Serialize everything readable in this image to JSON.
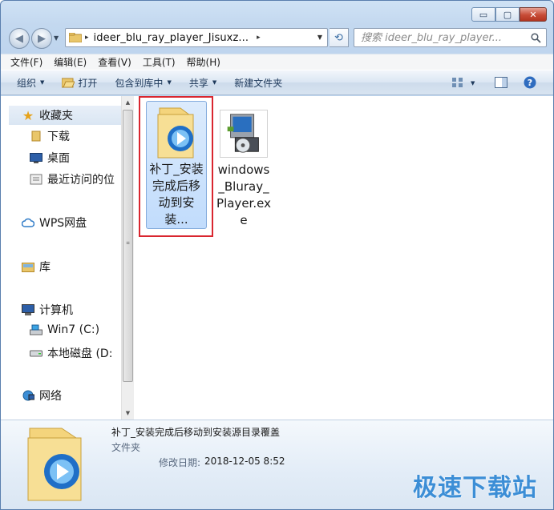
{
  "window": {
    "minimize": "▭",
    "maximize": "▢",
    "close": "✕"
  },
  "address": {
    "path": "ideer_blu_ray_player_Jisuxz...",
    "separator": "▸"
  },
  "search": {
    "placeholder": "搜索 ideer_blu_ray_player..."
  },
  "menubar": {
    "items": [
      "文件(F)",
      "编辑(E)",
      "查看(V)",
      "工具(T)",
      "帮助(H)"
    ]
  },
  "toolbar": {
    "organize": "组织",
    "open": "打开",
    "include_in_library": "包含到库中",
    "share": "共享",
    "new_folder": "新建文件夹"
  },
  "navpane": {
    "favorites": "收藏夹",
    "downloads": "下载",
    "desktop": "桌面",
    "recent": "最近访问的位",
    "wps": "WPS网盘",
    "library": "库",
    "computer": "计算机",
    "win7": "Win7 (C:)",
    "local_disk": "本地磁盘 (D:",
    "network": "网络"
  },
  "files": [
    {
      "name": "补丁_安装完成后移动到安装...",
      "type": "folder",
      "selected": true
    },
    {
      "name": "windows_Bluray_Player.exe",
      "type": "installer",
      "selected": false
    }
  ],
  "details": {
    "title": "补丁_安装完成后移动到安装源目录覆盖",
    "type": "文件夹",
    "date_label": "修改日期:",
    "date": "2018-12-05 8:52"
  },
  "watermark": "极速下载站",
  "colors": {
    "selection": "#c1dcfc",
    "highlight_border": "#d9262f",
    "watermark": "#3c8ed6"
  }
}
